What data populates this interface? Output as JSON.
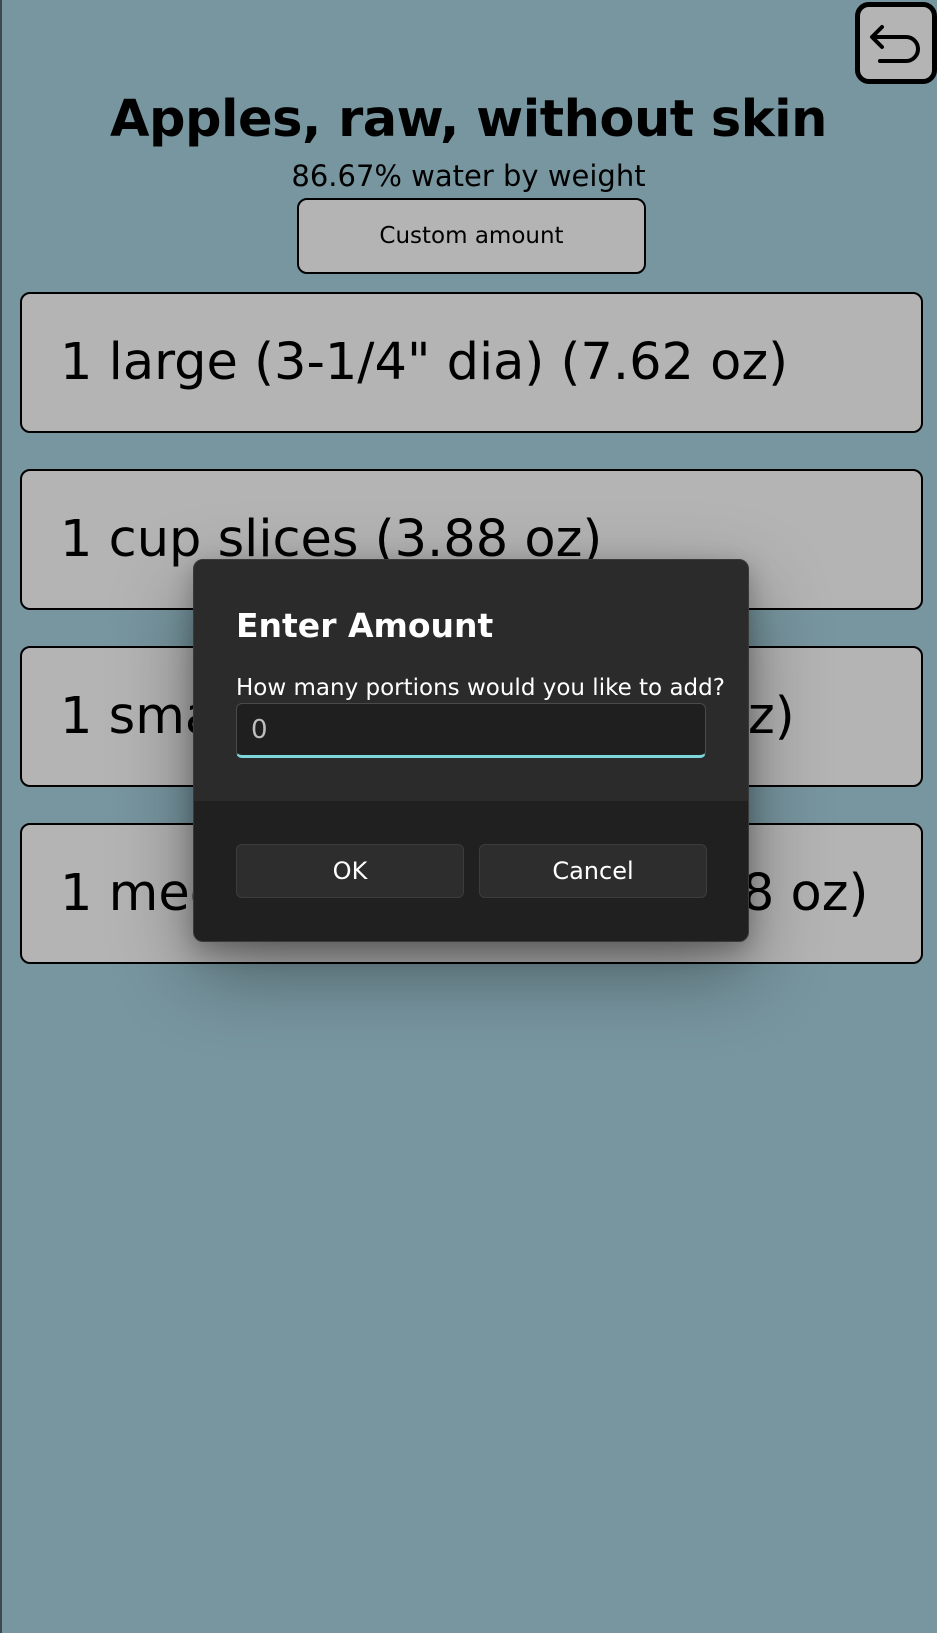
{
  "header": {
    "title": "Apples, raw, without skin",
    "subtitle": "86.67% water by weight",
    "back_icon": "back-arrow-icon"
  },
  "custom_button": {
    "label": "Custom amount"
  },
  "portions": [
    {
      "label": "1 large (3-1/4\" dia) (7.62 oz)"
    },
    {
      "label": "1 cup slices (3.88 oz)"
    },
    {
      "label": "1 small (2-1/2\" dia) (4.44 oz)"
    },
    {
      "label": "1 medium (2-3/4\" dia) (5.68 oz)"
    }
  ],
  "dialog": {
    "title": "Enter Amount",
    "message": "How many portions would you like to add?",
    "input_placeholder": "0",
    "ok_label": "OK",
    "cancel_label": "Cancel"
  },
  "colors": {
    "background": "#7896a0",
    "card": "#b4b4b4",
    "dialog": "#2b2b2b",
    "dialog_footer": "#202020",
    "input_accent": "#7ed6dd"
  }
}
